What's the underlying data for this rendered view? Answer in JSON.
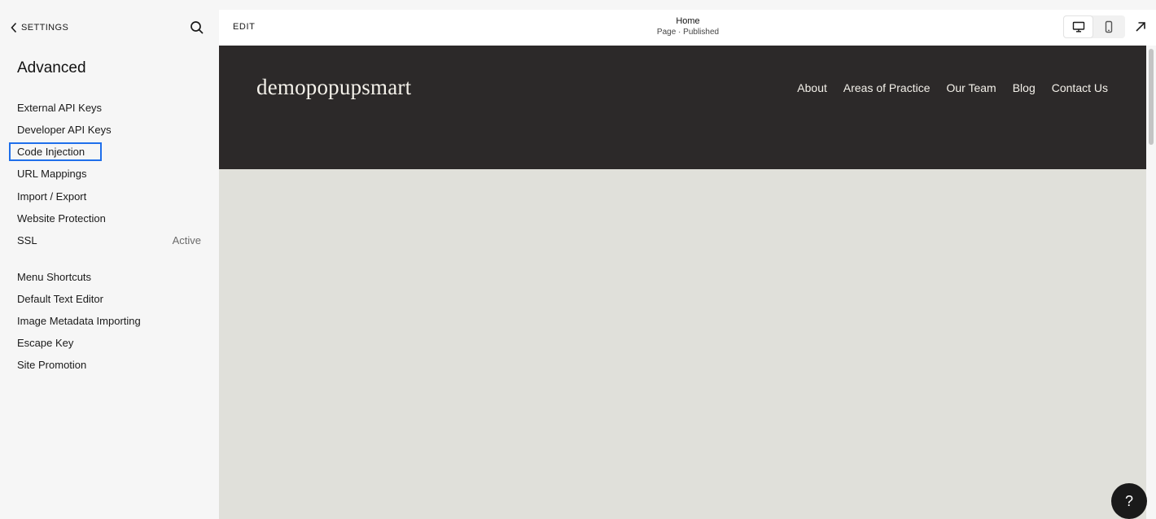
{
  "sidebar": {
    "back_label": "SETTINGS",
    "title": "Advanced",
    "items": [
      {
        "label": "External API Keys",
        "status": ""
      },
      {
        "label": "Developer API Keys",
        "status": ""
      },
      {
        "label": "Code Injection",
        "status": ""
      },
      {
        "label": "URL Mappings",
        "status": ""
      },
      {
        "label": "Import / Export",
        "status": ""
      },
      {
        "label": "Website Protection",
        "status": ""
      },
      {
        "label": "SSL",
        "status": "Active"
      },
      {
        "label": "Menu Shortcuts",
        "status": ""
      },
      {
        "label": "Default Text Editor",
        "status": ""
      },
      {
        "label": "Image Metadata Importing",
        "status": ""
      },
      {
        "label": "Escape Key",
        "status": ""
      },
      {
        "label": "Site Promotion",
        "status": ""
      }
    ],
    "focused_item": "Code Injection"
  },
  "topbar": {
    "edit_label": "EDIT",
    "page_name": "Home",
    "page_status": "Page · Published",
    "view_modes": [
      "desktop-icon",
      "mobile-icon"
    ],
    "active_view": "desktop-icon",
    "open_icon": "external-arrow-icon"
  },
  "site": {
    "logo": "demopopupsmart",
    "nav": [
      "About",
      "Areas of Practice",
      "Our Team",
      "Blog",
      "Contact Us"
    ],
    "colors": {
      "header_bg": "#2c2929",
      "body_bg": "#e0e0da",
      "nav_text": "#f4f1ea"
    }
  },
  "help": {
    "label": "?"
  },
  "colors": {
    "focus_ring": "#1f6feb",
    "sidebar_bg": "#f6f6f6"
  }
}
